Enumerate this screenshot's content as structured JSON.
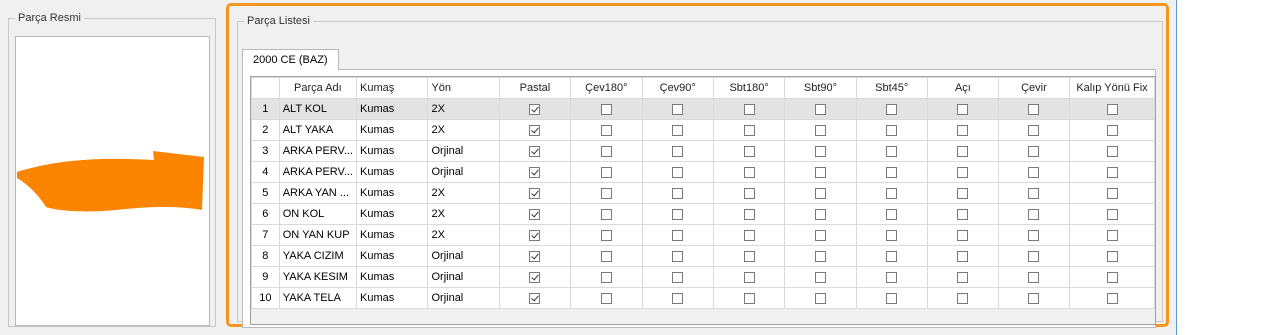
{
  "left_panel": {
    "title": "Parça Resmi"
  },
  "list_panel": {
    "title": "Parça Listesi",
    "tab_label": "2000 CE (BAZ)"
  },
  "columns": [
    "",
    "Parça Adı",
    "Kumaş",
    "Yön",
    "Pastal",
    "Çev180°",
    "Çev90°",
    "Sbt180°",
    "Sbt90°",
    "Sbt45°",
    "Açı",
    "Çevir",
    "Kalıp Yönü Fix"
  ],
  "rows": [
    {
      "no": "1",
      "name": "ALT KOL",
      "fabric": "Kumas",
      "dir": "2X",
      "checks": [
        true,
        false,
        false,
        false,
        false,
        false,
        false,
        false,
        false
      ]
    },
    {
      "no": "2",
      "name": "ALT YAKA",
      "fabric": "Kumas",
      "dir": "2X",
      "checks": [
        true,
        false,
        false,
        false,
        false,
        false,
        false,
        false,
        false
      ]
    },
    {
      "no": "3",
      "name": "ARKA PERV...",
      "fabric": "Kumas",
      "dir": "Orjinal",
      "checks": [
        true,
        false,
        false,
        false,
        false,
        false,
        false,
        false,
        false
      ]
    },
    {
      "no": "4",
      "name": "ARKA PERV...",
      "fabric": "Kumas",
      "dir": "Orjinal",
      "checks": [
        true,
        false,
        false,
        false,
        false,
        false,
        false,
        false,
        false
      ]
    },
    {
      "no": "5",
      "name": "ARKA YAN ...",
      "fabric": "Kumas",
      "dir": "2X",
      "checks": [
        true,
        false,
        false,
        false,
        false,
        false,
        false,
        false,
        false
      ]
    },
    {
      "no": "6",
      "name": "ON KOL",
      "fabric": "Kumas",
      "dir": "2X",
      "checks": [
        true,
        false,
        false,
        false,
        false,
        false,
        false,
        false,
        false
      ]
    },
    {
      "no": "7",
      "name": "ON YAN KUP",
      "fabric": "Kumas",
      "dir": "2X",
      "checks": [
        true,
        false,
        false,
        false,
        false,
        false,
        false,
        false,
        false
      ]
    },
    {
      "no": "8",
      "name": "YAKA CIZIM",
      "fabric": "Kumas",
      "dir": "Orjinal",
      "checks": [
        true,
        false,
        false,
        false,
        false,
        false,
        false,
        false,
        false
      ]
    },
    {
      "no": "9",
      "name": "YAKA KESIM",
      "fabric": "Kumas",
      "dir": "Orjinal",
      "checks": [
        true,
        false,
        false,
        false,
        false,
        false,
        false,
        false,
        false
      ]
    },
    {
      "no": "10",
      "name": "YAKA TELA",
      "fabric": "Kumas",
      "dir": "Orjinal",
      "checks": [
        true,
        false,
        false,
        false,
        false,
        false,
        false,
        false,
        false
      ]
    }
  ],
  "selected_row": 0,
  "colors": {
    "highlight": "#f7941d",
    "piece_fill": "#fb8500",
    "selected_row": "#e3e3e3"
  }
}
